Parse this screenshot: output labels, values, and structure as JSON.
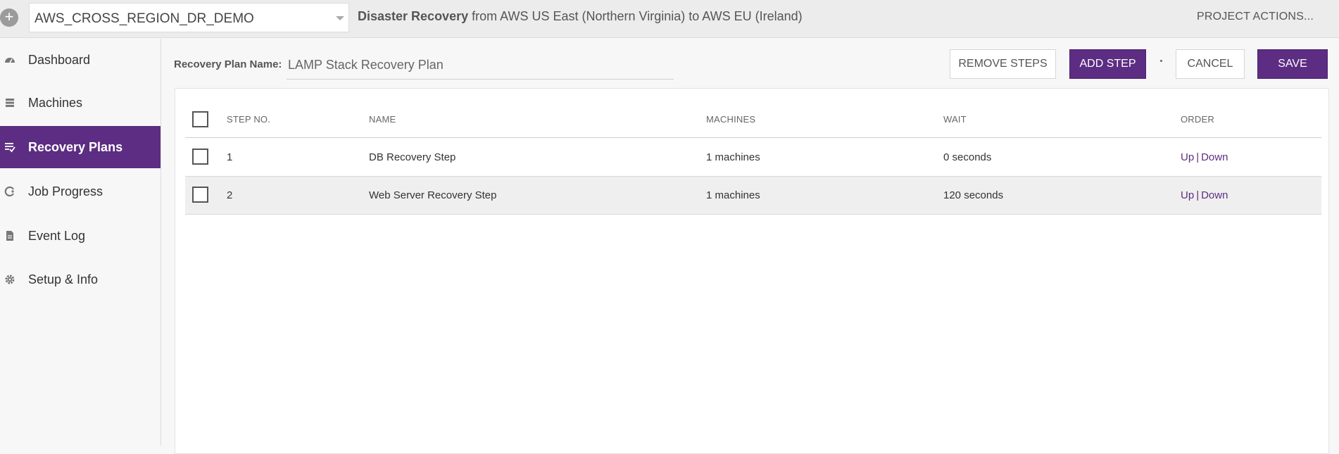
{
  "header": {
    "project_name": "AWS_CROSS_REGION_DR_DEMO",
    "title_bold": "Disaster Recovery",
    "title_rest": "from AWS US East (Northern Virginia) to AWS EU (Ireland)",
    "project_actions": "PROJECT ACTIONS...",
    "add_symbol": "+"
  },
  "sidebar": {
    "items": [
      {
        "label": "Dashboard",
        "icon": "dashboard-icon"
      },
      {
        "label": "Machines",
        "icon": "machines-icon"
      },
      {
        "label": "Recovery Plans",
        "icon": "recovery-plans-icon",
        "active": true
      },
      {
        "label": "Job Progress",
        "icon": "job-progress-icon"
      },
      {
        "label": "Event Log",
        "icon": "event-log-icon"
      },
      {
        "label": "Setup & Info",
        "icon": "gear-icon"
      }
    ]
  },
  "plan": {
    "name_label": "Recovery Plan Name:",
    "name_value": "LAMP Stack Recovery Plan"
  },
  "toolbar": {
    "remove_steps": "REMOVE STEPS",
    "add_step": "ADD STEP",
    "cancel": "CANCEL",
    "save": "SAVE"
  },
  "table": {
    "headers": [
      "STEP NO.",
      "NAME",
      "MACHINES",
      "WAIT",
      "ORDER"
    ],
    "rows": [
      {
        "step": "1",
        "name": "DB Recovery Step",
        "machines": "1 machines",
        "wait": "0 seconds",
        "up": "Up",
        "sep": "|",
        "down": "Down"
      },
      {
        "step": "2",
        "name": "Web Server Recovery Step",
        "machines": "1 machines",
        "wait": "120 seconds",
        "up": "Up",
        "sep": "|",
        "down": "Down"
      }
    ]
  },
  "colors": {
    "accent": "#5c2d82",
    "topbar_bg": "#ececec",
    "row_alt_bg": "#efefef"
  }
}
